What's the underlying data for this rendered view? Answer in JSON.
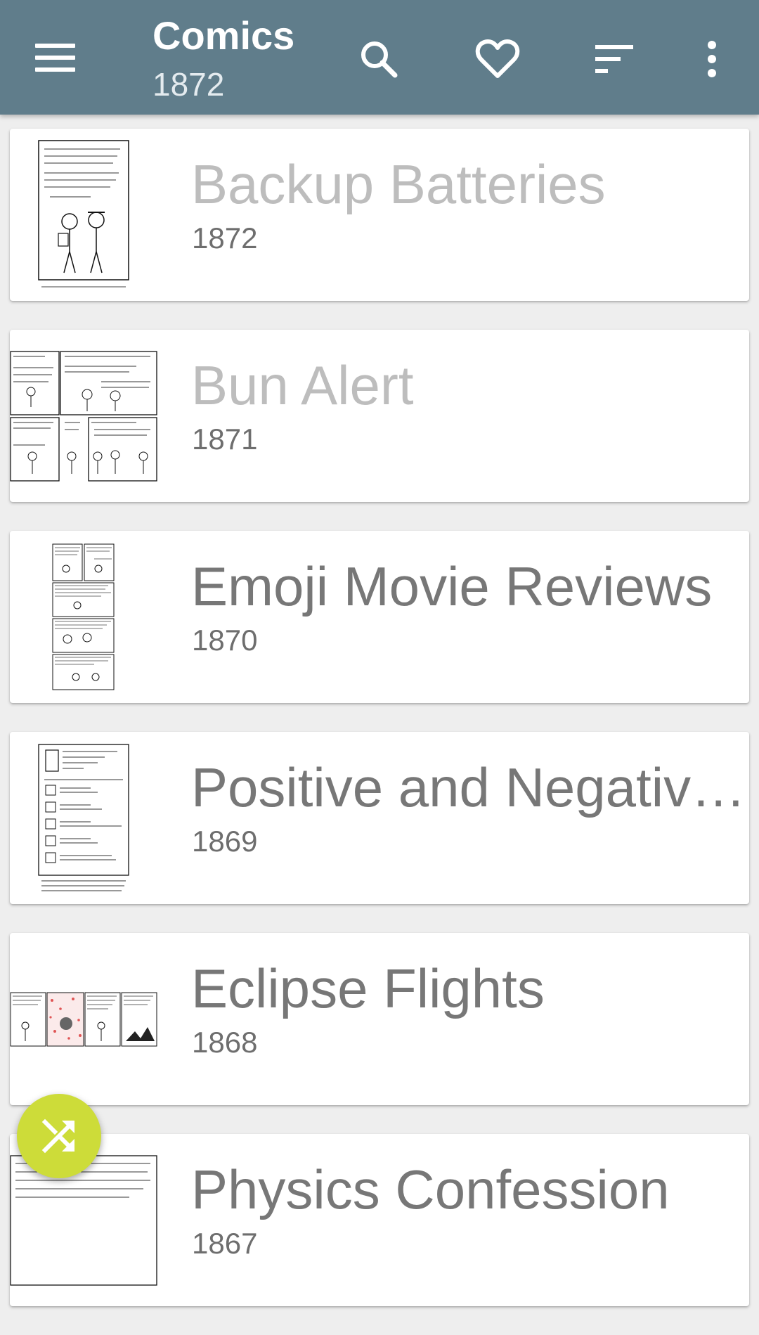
{
  "appbar": {
    "title": "Comics",
    "subtitle": "1872",
    "background": "#607d8b",
    "actions": [
      "menu-icon",
      "search-icon",
      "heart-icon",
      "sort-icon",
      "more-vert-icon"
    ]
  },
  "comics": [
    {
      "title": "Backup Batteries",
      "number": "1872",
      "read": true
    },
    {
      "title": "Bun Alert",
      "number": "1871",
      "read": true
    },
    {
      "title": "Emoji Movie Reviews",
      "number": "1870",
      "read": false
    },
    {
      "title": "Positive and Negativ…",
      "number": "1869",
      "read": false
    },
    {
      "title": "Eclipse Flights",
      "number": "1868",
      "read": false
    },
    {
      "title": "Physics Confession",
      "number": "1867",
      "read": false
    }
  ],
  "fab": {
    "icon": "shuffle-icon",
    "color": "#cddc39"
  }
}
